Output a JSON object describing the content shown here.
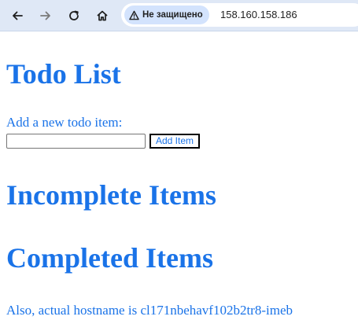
{
  "browser": {
    "security_label": "Не защищено",
    "url": "158.160.158.186",
    "icons": {
      "back": "back-arrow-icon",
      "forward": "forward-arrow-icon",
      "reload": "reload-icon",
      "home": "home-icon",
      "security": "warning-triangle-icon"
    }
  },
  "page": {
    "title": "Todo List",
    "add_label": "Add a new todo item:",
    "input_value": "",
    "add_button_label": "Add Item",
    "incomplete_heading": "Incomplete Items",
    "completed_heading": "Completed Items",
    "hostname_text": "Also, actual hostname is cl171nbehavf102b2tr8-imeb"
  },
  "colors": {
    "text_accent": "#1a73e8",
    "toolbar_bg": "#dfe8f6",
    "chip_bg": "#d3e3fd"
  }
}
